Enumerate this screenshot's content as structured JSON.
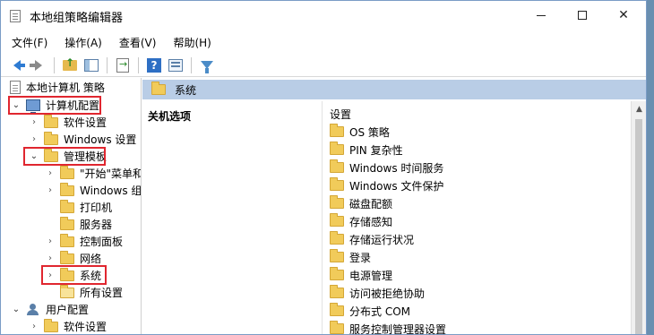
{
  "window": {
    "title": "本地组策略编辑器",
    "minimize_label": "—",
    "maximize_label": "□",
    "close_label": "✕"
  },
  "menu": [
    {
      "label": "文件(F)"
    },
    {
      "label": "操作(A)"
    },
    {
      "label": "查看(V)"
    },
    {
      "label": "帮助(H)"
    }
  ],
  "toolbar": {
    "icons": [
      "back-arrow-icon",
      "forward-arrow-icon",
      "up-folder-icon",
      "show-hide-tree-icon",
      "export-list-icon",
      "help-icon",
      "view-icon",
      "filter-icon"
    ]
  },
  "tree": {
    "root": "本地计算机 策略",
    "computer_config": "计算机配置",
    "software_settings": "软件设置",
    "windows_settings": "Windows 设置",
    "admin_templates": "管理模板",
    "start_menu": "\"开始\"菜单和",
    "windows_components": "Windows 组",
    "printers": "打印机",
    "server": "服务器",
    "control_panel": "控制面板",
    "network": "网络",
    "system": "系统",
    "all_settings": "所有设置",
    "user_config": "用户配置",
    "user_software_settings": "软件设置"
  },
  "right": {
    "header": "系统",
    "description_label": "关机选项",
    "list_header": "设置",
    "items": [
      "OS 策略",
      "PIN 复杂性",
      "Windows 时间服务",
      "Windows 文件保护",
      "磁盘配额",
      "存储感知",
      "存储运行状况",
      "登录",
      "电源管理",
      "访问被拒绝协助",
      "分布式 COM",
      "服务控制管理器设置"
    ]
  },
  "colors": {
    "highlight_box": "#e0262f",
    "header_bg": "#b9cde6",
    "folder": "#f1cb5a"
  }
}
